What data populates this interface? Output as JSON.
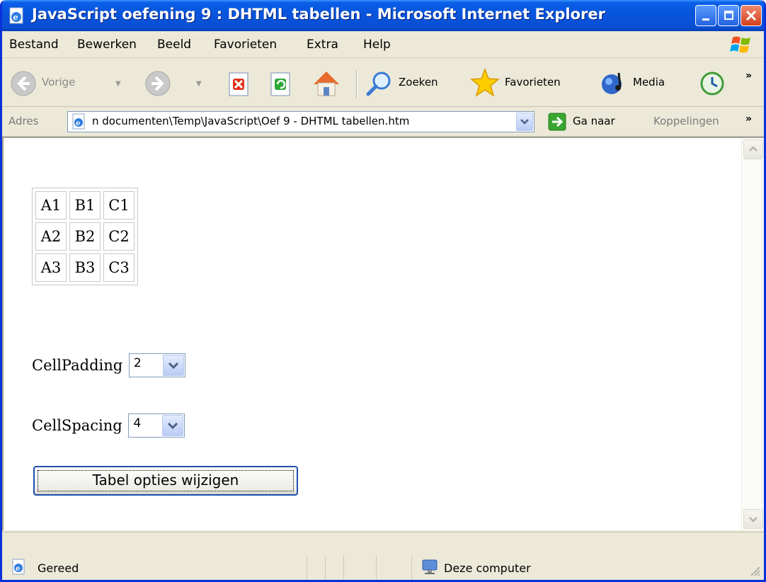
{
  "window": {
    "title": "JavaScript oefening 9 : DHTML tabellen - Microsoft Internet Explorer"
  },
  "menu": {
    "items": [
      {
        "label": "Bestand"
      },
      {
        "label": "Bewerken"
      },
      {
        "label": "Beeld"
      },
      {
        "label": "Favorieten"
      },
      {
        "label": "Extra"
      },
      {
        "label": "Help"
      }
    ]
  },
  "toolbar": {
    "back_label": "Vorige",
    "search_label": "Zoeken",
    "favorites_label": "Favorieten",
    "media_label": "Media"
  },
  "address": {
    "label": "Adres",
    "value": "n documenten\\Temp\\JavaScript\\Oef 9 - DHTML tabellen.htm",
    "go_label": "Ga naar",
    "links_label": "Koppelingen"
  },
  "page": {
    "table": [
      [
        "A1",
        "B1",
        "C1"
      ],
      [
        "A2",
        "B2",
        "C2"
      ],
      [
        "A3",
        "B3",
        "C3"
      ]
    ],
    "cellpadding_label": "CellPadding",
    "cellpadding_value": "2",
    "cellspacing_label": "CellSpacing",
    "cellspacing_value": "4",
    "button_label": "Tabel opties wijzigen"
  },
  "status": {
    "text": "Gereed",
    "zone": "Deze computer"
  },
  "colors": {
    "titlebar": "#0a5fe8",
    "chrome": "#ece9d8",
    "button_border": "#1c51b1"
  }
}
